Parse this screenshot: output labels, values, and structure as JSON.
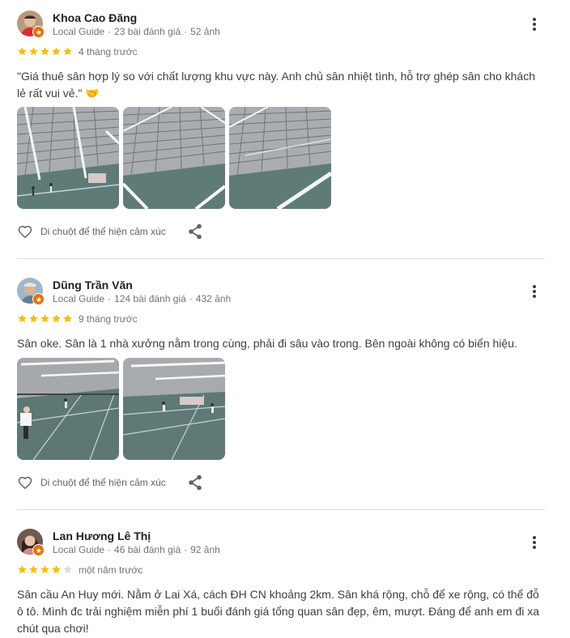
{
  "reviews": [
    {
      "name": "Khoa Cao Đăng",
      "guide_label": "Local Guide",
      "review_count": "23 bài đánh giá",
      "photo_count": "52 ảnh",
      "rating": 5,
      "time": "4 tháng trước",
      "text": "\"Giá thuê sân hợp lý so với chất lượng khu vực này. Anh chủ sân nhiệt tình, hỗ trợ ghép sân cho khách lẻ rất vui vẻ.\" 🤝",
      "like_label": "Di chuột để thể hiện cảm xúc"
    },
    {
      "name": "Dũng Trần Văn",
      "guide_label": "Local Guide",
      "review_count": "124 bài đánh giá",
      "photo_count": "432 ảnh",
      "rating": 5,
      "time": "9 tháng trước",
      "text": "Sân oke. Sân là 1 nhà xưởng nằm trong cùng, phải đi sâu vào trong. Bên ngoài không có biển hiệu.",
      "like_label": "Di chuột để thể hiện cảm xúc"
    },
    {
      "name": "Lan Hương Lê Thị",
      "guide_label": "Local Guide",
      "review_count": "46 bài đánh giá",
      "photo_count": "92 ảnh",
      "rating": 4,
      "time": "một năm trước",
      "text": "Sân cầu An Huy mới. Nằm ở Lai Xá, cách ĐH CN khoảng 2km. Sân khá rộng, chỗ để xe rộng, có thể đỗ ô tô. Mình đc trải nghiệm miễn phí 1 buổi đánh giá tổng quan sân đẹp, êm, mượt. Đáng để anh em đi xa chút qua chơi!"
    }
  ],
  "colors": {
    "star_filled": "#fbbc04",
    "star_empty": "#dadce0",
    "guide_badge": "#e8710a",
    "divider": "#dadce0"
  },
  "icons": [
    "more-vert-icon",
    "star-icon",
    "heart-outline-icon",
    "share-icon",
    "local-guide-badge-icon"
  ]
}
